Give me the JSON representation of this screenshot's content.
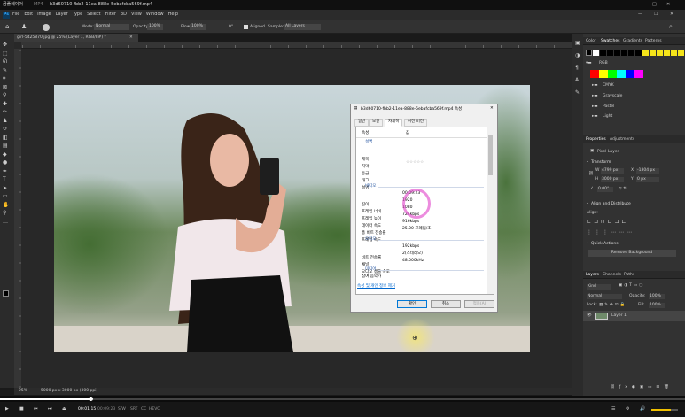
{
  "player": {
    "app_name": "곰플레이어",
    "format": "MP4",
    "title": "b3d60710-fbb2-11ea-888e-5ebafcba569f.mp4",
    "time_current": "00:01:15",
    "time_total": "00:09:23",
    "badges": [
      "S/W",
      "SRT",
      "CC",
      "HEVC"
    ]
  },
  "ps": {
    "logo": "Ps",
    "menu": [
      "File",
      "Edit",
      "Image",
      "Layer",
      "Type",
      "Select",
      "Filter",
      "3D",
      "View",
      "Window",
      "Help"
    ],
    "options": {
      "mode_label": "Mode:",
      "mode_value": "Normal",
      "opacity_label": "Opacity:",
      "opacity_value": "100%",
      "flow_label": "Flow:",
      "flow_value": "100%",
      "angle_value": "0°",
      "aligned_label": "Aligned",
      "sample_label": "Sample:",
      "sample_value": "All Layers"
    },
    "doc_tab": "girl-5425870.jpg @ 25% (Layer 1, RGB/8#) *",
    "status": {
      "zoom": "25%",
      "info": "5000 px x 3000 px (300 ppi)"
    },
    "panels": {
      "swatches_tabs": [
        "Color",
        "Swatches",
        "Gradients",
        "Patterns"
      ],
      "swatch_groups": [
        "RGB",
        "CMYK",
        "Grayscale",
        "Pastel",
        "Light"
      ],
      "props_tabs": [
        "Properties",
        "Adjustments"
      ],
      "pixel_layer": "Pixel Layer",
      "transform_label": "Transform",
      "w_value": "4799 px",
      "x_value": "-1304 px",
      "h_value": "3000 px",
      "y_value": "0 px",
      "angle_value": "0.00°",
      "align_label": "Align and Distribute",
      "align_sub": "Align:",
      "quick_actions": "Quick Actions",
      "remove_bg": "Remove Background",
      "layers_tabs": [
        "Layers",
        "Channels",
        "Paths"
      ],
      "kind_label": "Kind",
      "blend_mode": "Normal",
      "opacity_label": "Opacity:",
      "opacity_value": "100%",
      "lock_label": "Lock:",
      "fill_label": "Fill:",
      "fill_value": "100%",
      "layer_name": "Layer 1"
    }
  },
  "dialog": {
    "title": "b3d60710-fbb2-11ea-888e-5ebafcba569f.mp4 속성",
    "tabs": [
      "일반",
      "보안",
      "자세히",
      "이전 버전"
    ],
    "col_property": "속성",
    "col_value": "값",
    "sections": {
      "desc": "설명",
      "video": "비디오",
      "audio": "오디오",
      "media": "미디어"
    },
    "desc_rows": [
      {
        "k": "제목",
        "v": ""
      },
      {
        "k": "자막",
        "v": ""
      },
      {
        "k": "등급",
        "v": "☆☆☆☆☆"
      },
      {
        "k": "태그",
        "v": ""
      },
      {
        "k": "설명",
        "v": ""
      }
    ],
    "video_rows": [
      {
        "k": "길이",
        "v": "00:09:23"
      },
      {
        "k": "프레임 너비",
        "v": "1920"
      },
      {
        "k": "프레임 높이",
        "v": "1080"
      },
      {
        "k": "데이터 속도",
        "v": "724kbps"
      },
      {
        "k": "총 비트 전송률",
        "v": "916kbps"
      },
      {
        "k": "프레임 속도",
        "v": "25.00 프레임/초"
      }
    ],
    "audio_rows": [
      {
        "k": "비트 전송률",
        "v": "192kbps"
      },
      {
        "k": "채널",
        "v": "2(스테레오)"
      },
      {
        "k": "오디오 샘플 속도",
        "v": "48.000kHz"
      }
    ],
    "media_row": "참여 음악가",
    "remove_link": "속성 및 개인 정보 제거",
    "ok": "확인",
    "cancel": "취소",
    "apply": "적용(A)"
  },
  "colors": {
    "accent": "#0078d7",
    "highlight_circle": "#e040c8",
    "cursor_glow": "#e0d040"
  }
}
